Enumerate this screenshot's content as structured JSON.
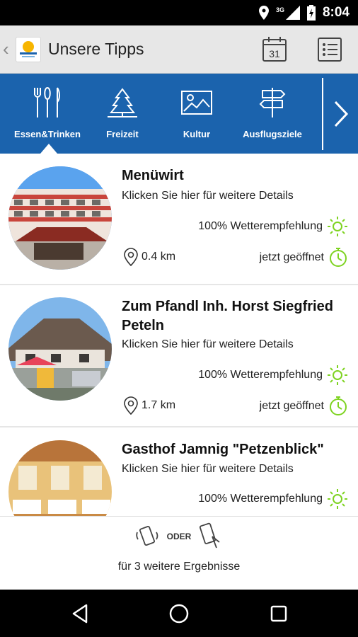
{
  "status_bar": {
    "time": "8:04",
    "network": "3G",
    "icons": [
      "location-icon",
      "signal-icon",
      "battery-icon"
    ]
  },
  "app_bar": {
    "title": "Unsere Tipps",
    "calendar_day": "31",
    "icons": [
      "back-icon",
      "app-logo",
      "calendar-icon",
      "list-icon"
    ]
  },
  "tabs": [
    {
      "label": "Essen&Trinken",
      "icon": "cutlery-icon",
      "selected": true
    },
    {
      "label": "Freizeit",
      "icon": "tree-icon",
      "selected": false
    },
    {
      "label": "Kultur",
      "icon": "picture-icon",
      "selected": false
    },
    {
      "label": "Ausflugsziele",
      "icon": "signpost-icon",
      "selected": false
    }
  ],
  "items": [
    {
      "name": "Menüwirt",
      "subtitle": "Klicken Sie hier für weitere Details",
      "weather": "100% Wetterempfehlung",
      "distance": "0.4 km",
      "status": "jetzt geöffnet"
    },
    {
      "name": "Zum Pfandl Inh. Horst Siegfried Peteln",
      "subtitle": "Klicken Sie hier für weitere Details",
      "weather": "100% Wetterempfehlung",
      "distance": "1.7 km",
      "status": "jetzt geöffnet"
    },
    {
      "name": "Gasthof Jamnig \"Petzenblick\"",
      "subtitle": "Klicken Sie hier für weitere Details",
      "weather": "100% Wetterempfehlung"
    }
  ],
  "footer": {
    "or_label": "ODER",
    "more_text": "für 3 weitere Ergebnisse"
  },
  "colors": {
    "accent": "#1b63ad",
    "green": "#7ed321",
    "appbar": "#e7e7e7"
  }
}
